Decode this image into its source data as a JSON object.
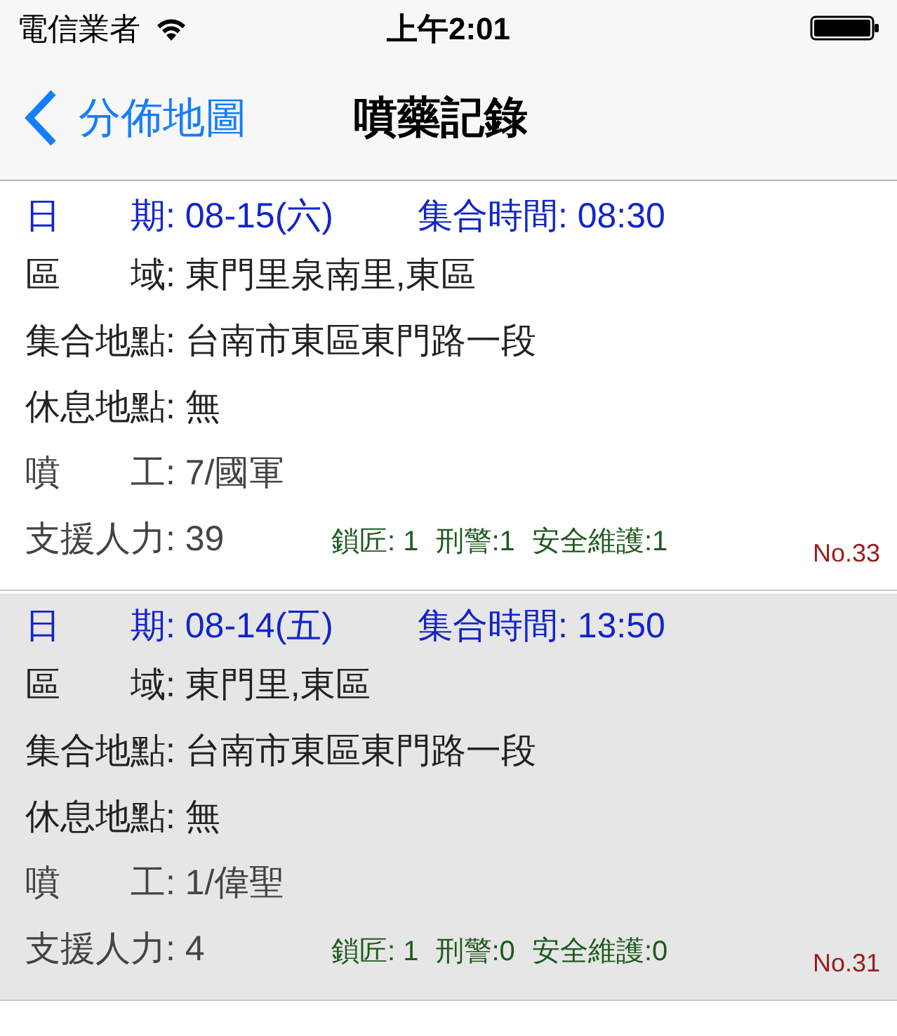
{
  "status_bar": {
    "carrier": "電信業者",
    "time": "上午2:01"
  },
  "nav": {
    "back": "分佈地圖",
    "title": "噴藥記錄"
  },
  "records": [
    {
      "selected": false,
      "date": "日　　期: 08-15(六)",
      "gather_time": "集合時間: 08:30",
      "area": "區　　域: 東門里泉南里,東區",
      "meeting_place": "集合地點: 台南市東區東門路一段",
      "rest_place": "休息地點: 無",
      "sprayer": "噴　　工: 7/國軍",
      "support": "支援人力: 39",
      "extras": [
        "鎖匠: 1",
        "刑警:1",
        "安全維護:1"
      ],
      "number": "No.33"
    },
    {
      "selected": true,
      "date": "日　　期: 08-14(五)",
      "gather_time": "集合時間: 13:50",
      "area": "區　　域: 東門里,東區",
      "meeting_place": "集合地點: 台南市東區東門路一段",
      "rest_place": "休息地點: 無",
      "sprayer": "噴　　工: 1/偉聖",
      "support": "支援人力: 4",
      "extras": [
        "鎖匠: 1",
        "刑警:0",
        "安全維護:0"
      ],
      "number": "No.31"
    }
  ]
}
